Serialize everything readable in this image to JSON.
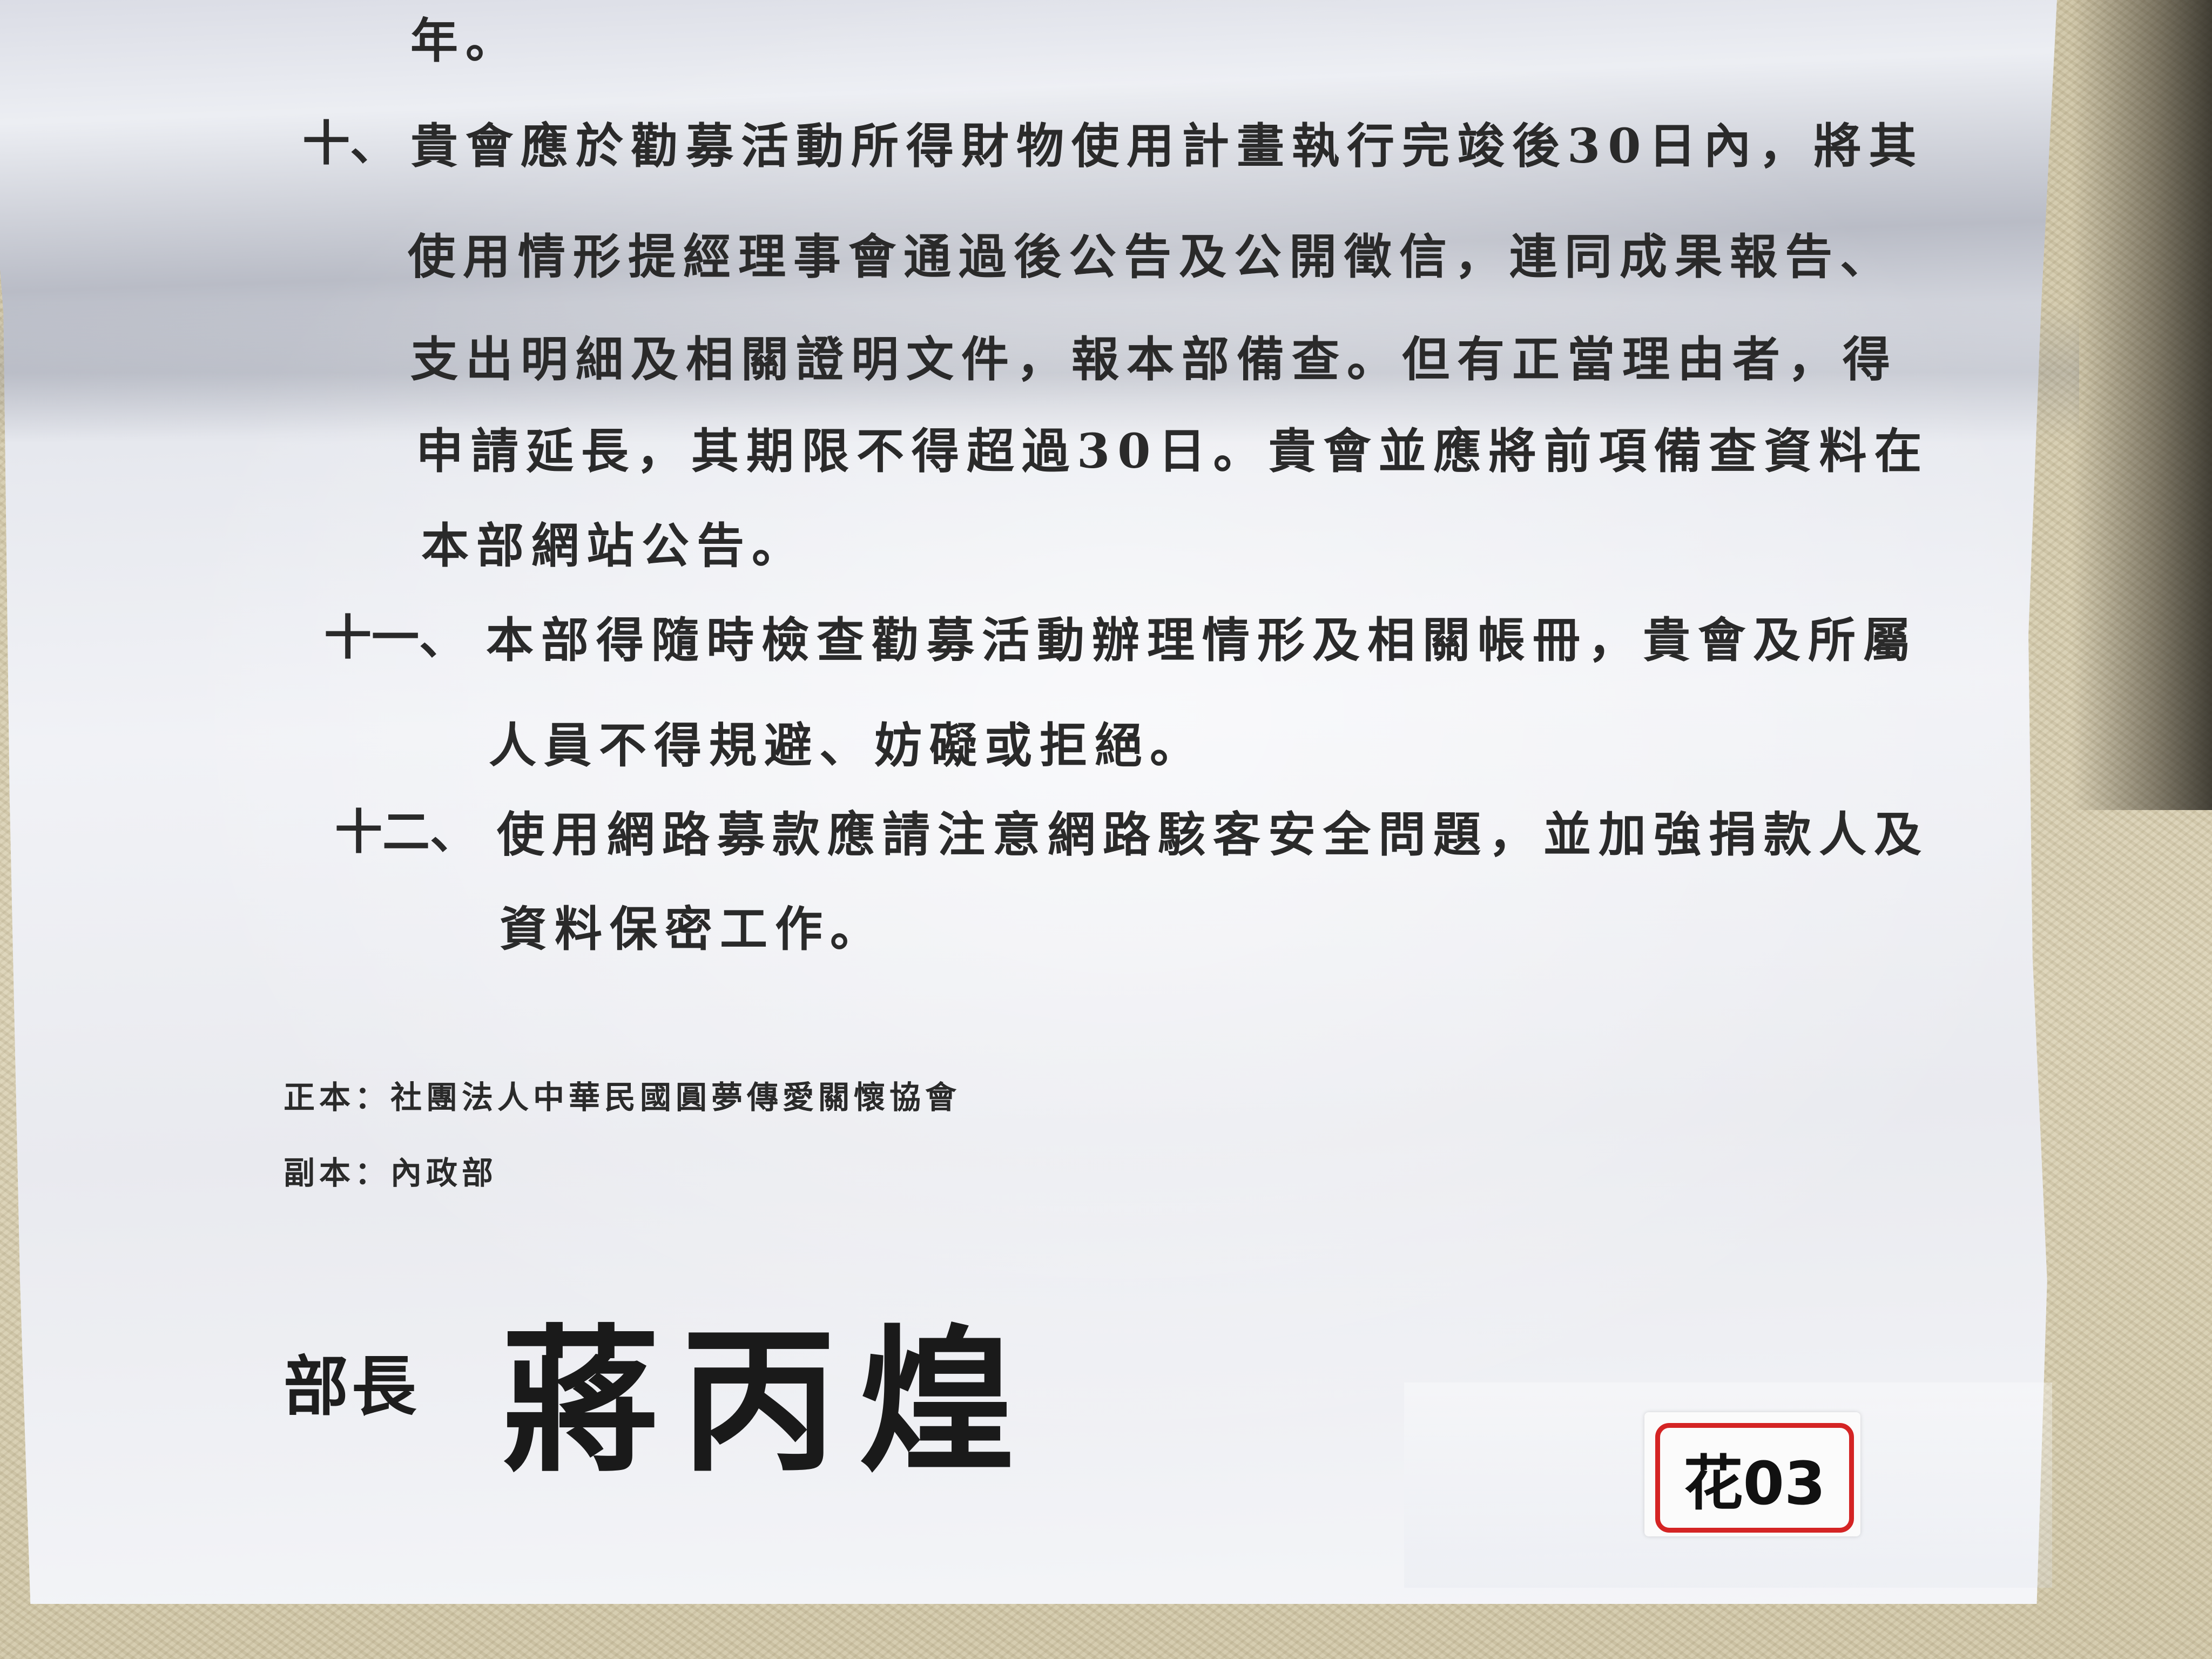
{
  "document": {
    "line_top": "年。",
    "item10": {
      "number": "十、",
      "lines": [
        "貴會應於勸募活動所得財物使用計畫執行完竣後30日內，將其",
        "使用情形提經理事會通過後公告及公開徵信，連同成果報告、",
        "支出明細及相關證明文件，報本部備查。但有正當理由者，得",
        "申請延長，其期限不得超過30日。貴會並應將前項備查資料在",
        "本部網站公告。"
      ]
    },
    "item11": {
      "number": "十一、",
      "lines": [
        "本部得隨時檢查勸募活動辦理情形及相關帳冊，貴會及所屬",
        "人員不得規避、妨礙或拒絕。"
      ]
    },
    "item12": {
      "number": "十二、",
      "lines": [
        "使用網路募款應請注意網路駭客安全問題，並加強捐款人及",
        "資料保密工作。"
      ]
    },
    "recipients": {
      "original": "正本：社團法人中華民國圓夢傳愛關懷協會",
      "copy": "副本：內政部"
    },
    "signature": {
      "title": "部長",
      "name": "蔣丙煌"
    },
    "tag_label": "花03"
  }
}
